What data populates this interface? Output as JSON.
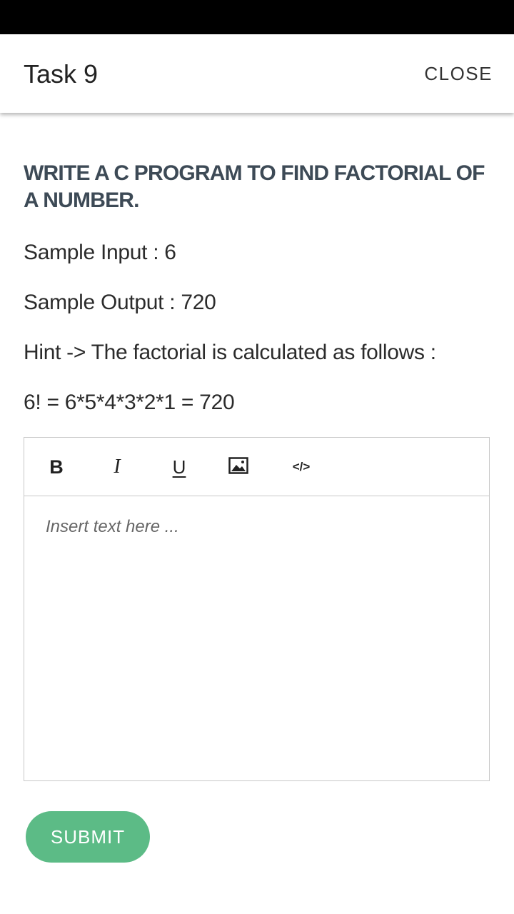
{
  "header": {
    "title": "Task 9",
    "close_label": "CLOSE"
  },
  "task": {
    "heading": "WRITE A C PROGRAM TO FIND FACTORIAL OF A NUMBER.",
    "sample_input": "Sample Input : 6",
    "sample_output": "Sample Output : 720",
    "hint": "Hint -> The factorial is calculated as follows :",
    "formula": "6! = 6*5*4*3*2*1 = 720"
  },
  "editor": {
    "toolbar": {
      "bold_label": "B",
      "italic_label": "I",
      "underline_label": "U",
      "image_icon": "image-icon",
      "code_label": "</>"
    },
    "placeholder": "Insert text here ..."
  },
  "footer": {
    "submit_label": "SUBMIT"
  },
  "colors": {
    "status_bar": "#000000",
    "heading": "#3d4a56",
    "submit_button": "#5cbb86"
  }
}
